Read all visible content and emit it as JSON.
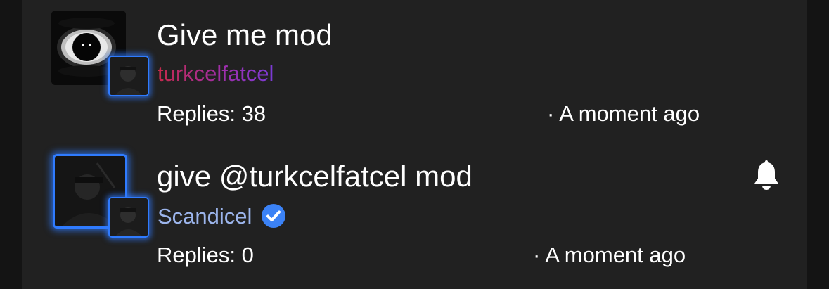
{
  "threads": [
    {
      "title": "Give me mod",
      "author": "turkcelfatcel",
      "replies": "Replies: 38",
      "time": "· A moment ago",
      "verified": false,
      "bell": false,
      "avatar_icon": "eye-avatar-icon"
    },
    {
      "title": "give @turkcelfatcel mod",
      "author": "Scandicel",
      "replies": "Replies: 0",
      "time": "· A moment ago",
      "verified": true,
      "bell": true,
      "avatar_icon": "user-photo-avatar-icon"
    }
  ],
  "colors": {
    "background": "#212121",
    "glow_blue": "#2f7bff",
    "verified_blue": "#3b82f6",
    "author_gradient_start": "#c4294a",
    "author_gradient_end": "#7b3bd6",
    "author_plain": "#9cb5ec"
  }
}
